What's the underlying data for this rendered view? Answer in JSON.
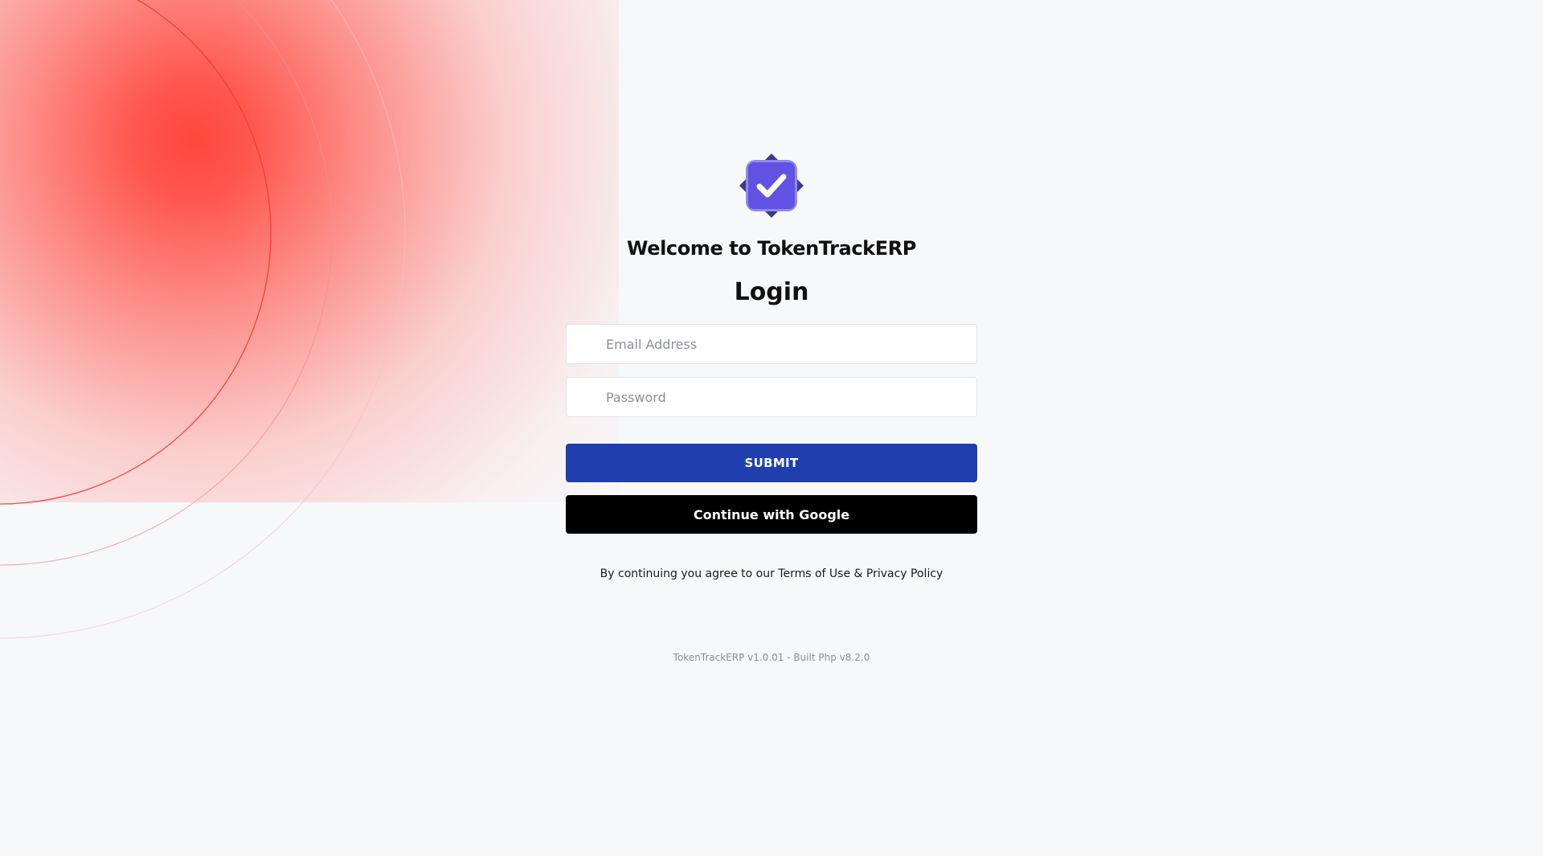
{
  "brand": {
    "welcome": "Welcome to TokenTrackERP",
    "logo_icon": "verified-check-badge-icon",
    "colors": {
      "badge_back": "#3d3a8c",
      "badge_mid": "#8f88f0",
      "badge_front": "#6152e3",
      "check": "#ffffff",
      "accent_glow": "#ff443a"
    }
  },
  "login": {
    "title": "Login",
    "email_placeholder": "Email Address",
    "password_placeholder": "Password",
    "submit_label": "SUBMIT",
    "google_label": "Continue with Google",
    "submit_color": "#1f3fae",
    "google_color": "#000000"
  },
  "terms": {
    "prefix": "By continuing you agree to our ",
    "terms_link": "Terms of Use",
    "separator": " & ",
    "privacy_link": "Privacy Policy"
  },
  "footer": {
    "version": "TokenTrackERP v1.0.01 - Built Php v8.2.0"
  }
}
